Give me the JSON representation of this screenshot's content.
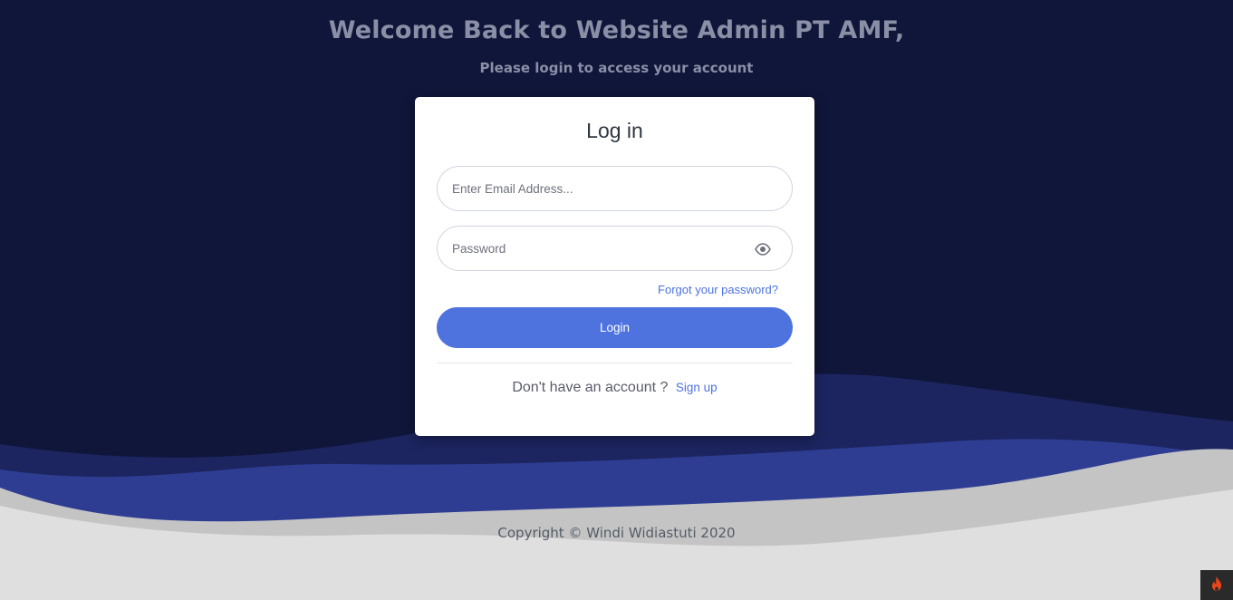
{
  "header": {
    "title": "Welcome Back to Website Admin PT AMF,",
    "subtitle": "Please login to access your account"
  },
  "login_card": {
    "title": "Log in",
    "email": {
      "placeholder": "Enter Email Address...",
      "value": ""
    },
    "password": {
      "placeholder": "Password",
      "value": "",
      "toggle_icon": "eye-icon"
    },
    "forgot_link": "Forgot your password?",
    "login_button": "Login",
    "signup_prompt": "Don't have an account ?",
    "signup_link": "Sign up"
  },
  "footer": {
    "copyright": "Copyright © Windi Widiastuti 2020"
  },
  "corner_badge": {
    "icon": "flame-icon"
  },
  "colors": {
    "background": "#10163a",
    "accent": "#4e73df",
    "wave_dark": "#1c2560",
    "wave_mid": "#2e3d92",
    "wave_light": "#c4c4c4",
    "footer_bg": "#dfdfdf"
  }
}
